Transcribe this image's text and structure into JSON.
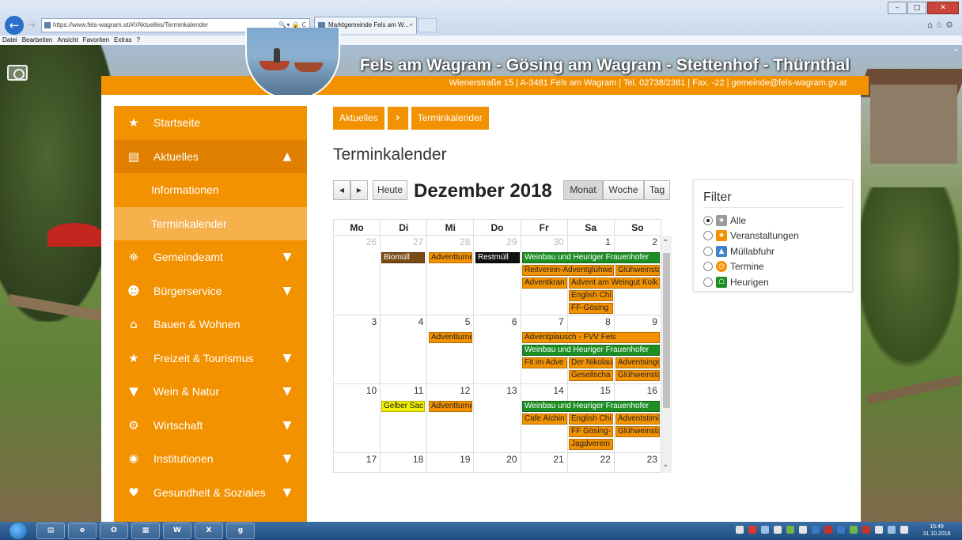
{
  "browser": {
    "url": "https://www.fels-wagram.at/#!/Aktuelles/Terminkalender",
    "tab_title": "Marktgemeinde Fels am W...",
    "tab_close": "×",
    "menu": [
      "Datei",
      "Bearbeiten",
      "Ansicht",
      "Favoriten",
      "Extras",
      "?"
    ]
  },
  "header": {
    "site_title": "Fels am Wagram - Gösing am Wagram - Stettenhof - Thürnthal",
    "info": "Wienerstraße 15 | A-3481 Fels am Wagram | Tel. 02738/2381 | Fax. -22 | gemeinde@fels-wagram.gv.at"
  },
  "sidebar": {
    "items": [
      {
        "label": "Startseite",
        "icon": "star-icon"
      },
      {
        "label": "Aktuelles",
        "icon": "newspaper-icon"
      },
      {
        "label": "Informationen"
      },
      {
        "label": "Terminkalender"
      },
      {
        "label": "Gemeindeamt",
        "icon": "townhall-icon"
      },
      {
        "label": "Bürgerservice",
        "icon": "users-icon"
      },
      {
        "label": "Bauen & Wohnen",
        "icon": "home-icon"
      },
      {
        "label": "Freizeit & Tourismus",
        "icon": "child-icon"
      },
      {
        "label": "Wein & Natur",
        "icon": "glass-icon"
      },
      {
        "label": "Wirtschaft",
        "icon": "gears-icon"
      },
      {
        "label": "Institutionen",
        "icon": "institution-icon"
      },
      {
        "label": "Gesundheit & Soziales",
        "icon": "heart-icon"
      }
    ]
  },
  "breadcrumb": {
    "parent": "Aktuelles",
    "current": "Terminkalender"
  },
  "page_title": "Terminkalender",
  "calendar": {
    "today": "Heute",
    "month_title": "Dezember 2018",
    "view_month": "Monat",
    "view_week": "Woche",
    "view_day": "Tag",
    "day_names": [
      "Mo",
      "Di",
      "Mi",
      "Do",
      "Fr",
      "Sa",
      "So"
    ],
    "weeks": [
      [
        "26",
        "27",
        "28",
        "29",
        "30",
        "1",
        "2"
      ],
      [
        "3",
        "4",
        "5",
        "6",
        "7",
        "8",
        "9"
      ],
      [
        "10",
        "11",
        "12",
        "13",
        "14",
        "15",
        "16"
      ],
      [
        "17",
        "18",
        "19",
        "20",
        "21",
        "22",
        "23"
      ]
    ],
    "events": {
      "w1": [
        "Biomüll",
        "Adventturne",
        "Restmüll",
        "Weinbau und Heuriger Frauenhofer",
        "Reitverein-Adventglühwe",
        "Glühweinsta",
        "Adventkran",
        "Advent am Weingut Kolk",
        "English Chi",
        "FF-Gösing"
      ],
      "w2": [
        "Adventturne",
        "Adventplausch - FVV Fels",
        "Weinbau und Heuriger Frauenhofer",
        "Fit im Adve",
        "Der Nikolau",
        "Adventsinge",
        "Gesellscha",
        "Glühweinsta"
      ],
      "w3": [
        "Gelber Sac",
        "Adventturne",
        "Weinbau und Heuriger Frauenhofer",
        "Cafe Aichin",
        "English Chi",
        "Adventstimi",
        "FF Gösing-",
        "Glühweinsta",
        "Jagdverein"
      ]
    },
    "colors": {
      "orange": "#f39200",
      "green": "#1c8e24",
      "brown": "#7a4b14",
      "black": "#111111",
      "yellow": "#f1ee00"
    }
  },
  "filter": {
    "title": "Filter",
    "options": [
      {
        "label": "Alle",
        "checked": true,
        "color": "#9a9a9a"
      },
      {
        "label": "Veranstaltungen",
        "checked": false,
        "color": "#f39200"
      },
      {
        "label": "Müllabfuhr",
        "checked": false,
        "color": "#3d83c6"
      },
      {
        "label": "Termine",
        "checked": false,
        "color": "#f39200"
      },
      {
        "label": "Heurigen",
        "checked": false,
        "color": "#1c8e24"
      }
    ]
  },
  "taskbar": {
    "time": "15:49",
    "date": "31.10.2018"
  }
}
